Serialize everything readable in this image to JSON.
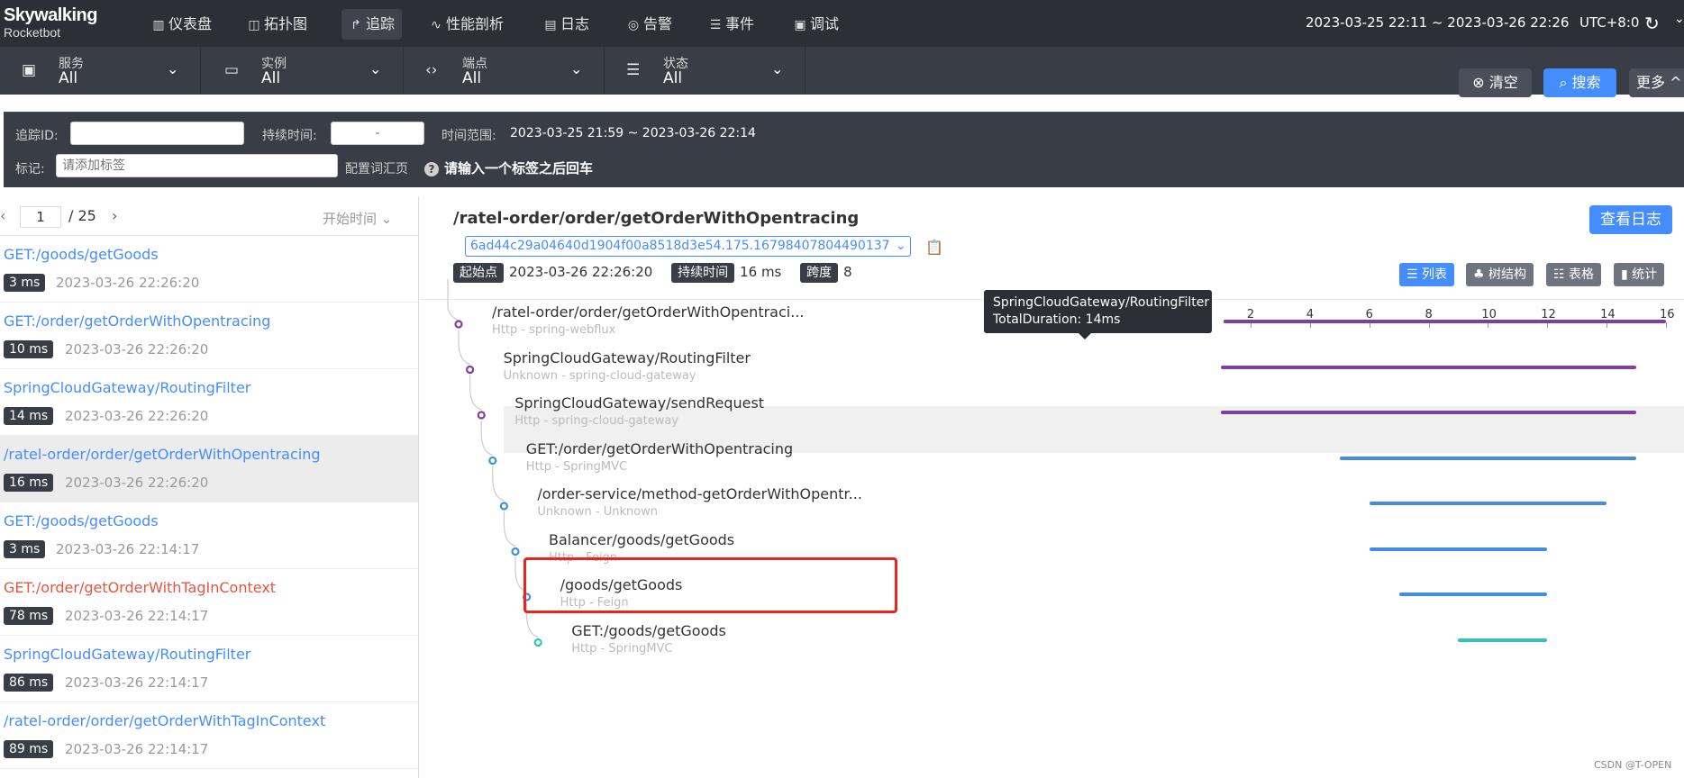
{
  "header": {
    "logo_title": "Skywalking",
    "logo_sub": "Rocketbot",
    "nav": [
      {
        "label": "仪表盘",
        "icon": "dashboard-icon",
        "glyph": "▥"
      },
      {
        "label": "拓扑图",
        "icon": "topology-icon",
        "glyph": "◫"
      },
      {
        "label": "追踪",
        "icon": "trace-icon",
        "glyph": "↱"
      },
      {
        "label": "性能剖析",
        "icon": "profile-icon",
        "glyph": "∿"
      },
      {
        "label": "日志",
        "icon": "log-icon",
        "glyph": "▤"
      },
      {
        "label": "告警",
        "icon": "alarm-icon",
        "glyph": "◎"
      },
      {
        "label": "事件",
        "icon": "event-icon",
        "glyph": "☰"
      },
      {
        "label": "调试",
        "icon": "debug-icon",
        "glyph": "▣"
      }
    ],
    "active_nav": "追踪",
    "date_range": "2023-03-25 22:11 ~ 2023-03-26 22:26",
    "timezone": "UTC+8:0"
  },
  "filters": [
    {
      "label": "服务",
      "value": "All",
      "icon": "service-icon"
    },
    {
      "label": "实例",
      "value": "All",
      "icon": "instance-icon"
    },
    {
      "label": "端点",
      "value": "All",
      "icon": "endpoint-icon"
    },
    {
      "label": "状态",
      "value": "All",
      "icon": "status-icon"
    }
  ],
  "actions": {
    "clear": "清空",
    "search": "搜索",
    "more": "更多"
  },
  "search": {
    "trace_id_label": "追踪ID:",
    "trace_id_value": "",
    "duration_label": "持续时间:",
    "duration_placeholder": "-",
    "time_range_label": "时间范围:",
    "time_range_value": "2023-03-25 21:59 ~ 2023-03-26 22:14",
    "tags_label": "标记:",
    "tags_placeholder": "请添加标签",
    "config_label": "配置词汇页",
    "tags_help": "请输入一个标签之后回车"
  },
  "pager": {
    "current": "1",
    "total": "/ 25",
    "sort": "开始时间"
  },
  "traces": [
    {
      "name": "GET:/goods/getGoods",
      "duration": "3 ms",
      "time": "2023-03-26 22:26:20",
      "error": false,
      "selected": false
    },
    {
      "name": "GET:/order/getOrderWithOpentracing",
      "duration": "10 ms",
      "time": "2023-03-26 22:26:20",
      "error": false,
      "selected": false
    },
    {
      "name": "SpringCloudGateway/RoutingFilter",
      "duration": "14 ms",
      "time": "2023-03-26 22:26:20",
      "error": false,
      "selected": false
    },
    {
      "name": "/ratel-order/order/getOrderWithOpentracing",
      "duration": "16 ms",
      "time": "2023-03-26 22:26:20",
      "error": false,
      "selected": true
    },
    {
      "name": "GET:/goods/getGoods",
      "duration": "3 ms",
      "time": "2023-03-26 22:14:17",
      "error": false,
      "selected": false
    },
    {
      "name": "GET:/order/getOrderWithTagInContext",
      "duration": "78 ms",
      "time": "2023-03-26 22:14:17",
      "error": true,
      "selected": false
    },
    {
      "name": "SpringCloudGateway/RoutingFilter",
      "duration": "86 ms",
      "time": "2023-03-26 22:14:17",
      "error": false,
      "selected": false
    },
    {
      "name": "/ratel-order/order/getOrderWithTagInContext",
      "duration": "89 ms",
      "time": "2023-03-26 22:14:17",
      "error": false,
      "selected": false
    }
  ],
  "detail": {
    "title": "/ratel-order/order/getOrderWithOpentracing",
    "trace_id": "6ad44c29a04640d1904f00a8518d3e54.175.16798407804490137",
    "view_logs": "查看日志",
    "start_label": "起始点",
    "start_value": "2023-03-26 22:26:20",
    "duration_label": "持续时间",
    "duration_value": "16 ms",
    "spans_label": "跨度",
    "spans_value": "8",
    "views": [
      "列表",
      "树结构",
      "表格",
      "统计"
    ],
    "active_view": "列表"
  },
  "timeline": {
    "ticks": [
      "0",
      "2",
      "4",
      "6",
      "8",
      "10",
      "12",
      "14",
      "16"
    ],
    "max_ms": 16
  },
  "spans": [
    {
      "name": "/ratel-order/order/getOrderWithOpentraci...",
      "sub": "Http - spring-webflux",
      "start_ms": 1.1,
      "end_ms": 16.0,
      "color": "#7e3fa0",
      "node_color": "#7e3fa0",
      "highlighted": false
    },
    {
      "name": "SpringCloudGateway/RoutingFilter",
      "sub": "Unknown - spring-cloud-gateway",
      "start_ms": 1.0,
      "end_ms": 15.0,
      "color": "#7e3fa0",
      "node_color": "#7e3fa0",
      "highlighted": true
    },
    {
      "name": "SpringCloudGateway/sendRequest",
      "sub": "Http - spring-cloud-gateway",
      "start_ms": 1.0,
      "end_ms": 15.0,
      "color": "#7e3fa0",
      "node_color": "#7e3fa0",
      "highlighted": false
    },
    {
      "name": "GET:/order/getOrderWithOpentracing",
      "sub": "Http - SpringMVC",
      "start_ms": 5.0,
      "end_ms": 15.0,
      "color": "#448dde",
      "node_color": "#448dde",
      "highlighted": false
    },
    {
      "name": "/order-service/method-getOrderWithOpentr...",
      "sub": "Unknown - Unknown",
      "start_ms": 6.0,
      "end_ms": 14.0,
      "color": "#448dde",
      "node_color": "#448dde",
      "highlighted": false
    },
    {
      "name": "Balancer/goods/getGoods",
      "sub": "Http - Feign",
      "start_ms": 6.0,
      "end_ms": 12.0,
      "color": "#448dde",
      "node_color": "#448dde",
      "highlighted": false
    },
    {
      "name": "/goods/getGoods",
      "sub": "Http - Feign",
      "start_ms": 7.0,
      "end_ms": 12.0,
      "color": "#448dde",
      "node_color": "#448dde",
      "highlighted": false
    },
    {
      "name": "GET:/goods/getGoods",
      "sub": "Http - SpringMVC",
      "start_ms": 9.0,
      "end_ms": 12.0,
      "color": "#2ec4b6",
      "node_color": "#2ec4b6",
      "highlighted": false
    }
  ],
  "tooltip": {
    "name": "SpringCloudGateway/RoutingFilter",
    "duration": "TotalDuration: 14ms"
  },
  "watermark": "CSDN @T-OPEN"
}
